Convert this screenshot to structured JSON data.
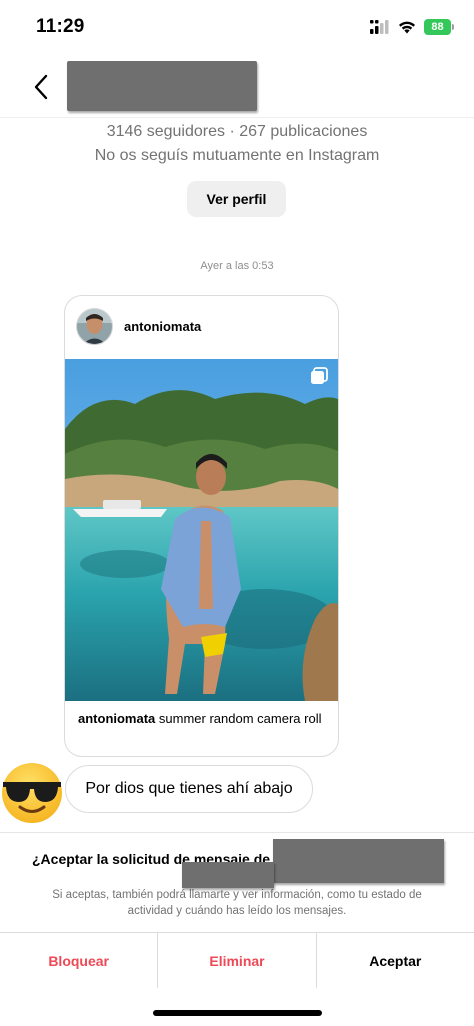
{
  "status_bar": {
    "time": "11:29",
    "battery": "88"
  },
  "header": {
    "back_icon": "chevron-left-icon"
  },
  "profile": {
    "stats": "3146 seguidores · 267 publicaciones",
    "mutual": "No os seguís mutuamente en Instagram",
    "view_profile_label": "Ver perfil"
  },
  "thread": {
    "timestamp": "Ayer a las 0:53",
    "shared_post": {
      "username": "antoniomata",
      "caption_user": "antoniomata",
      "caption_text": "summer random camera roll",
      "multi_image_icon": "carousel-icon"
    },
    "message": {
      "sender_emoji": "😎",
      "text": "Por dios que tienes ahí abajo"
    }
  },
  "request": {
    "title": "¿Aceptar la solicitud de mensaje de",
    "description": "Si aceptas, también podrá llamarte y ver información, como tu estado de actividad y cuándo has leído los mensajes."
  },
  "actions": {
    "block": "Bloquear",
    "delete": "Eliminar",
    "accept": "Aceptar"
  },
  "colors": {
    "danger": "#ed4956",
    "battery": "#34c759",
    "muted": "#737373"
  }
}
